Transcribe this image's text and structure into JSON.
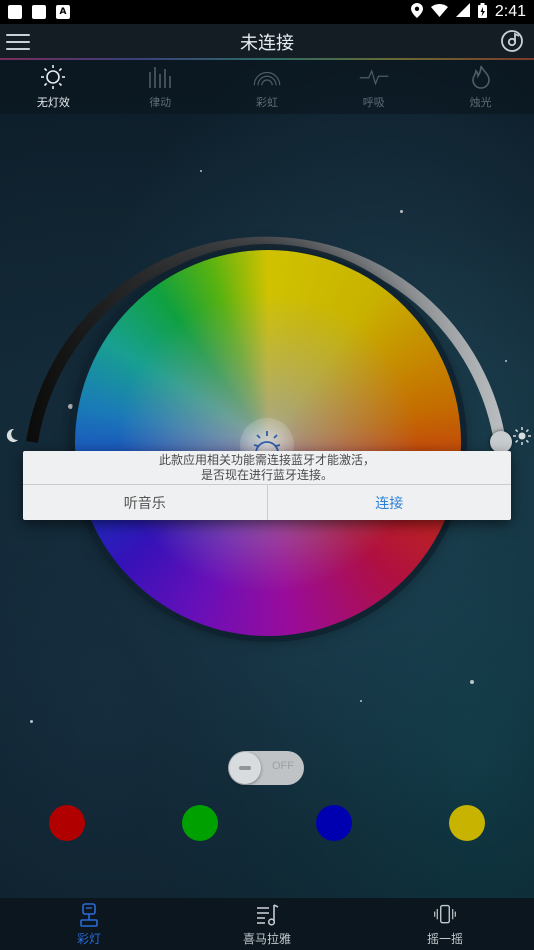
{
  "status_bar": {
    "time": "2:41"
  },
  "header": {
    "title": "未连接"
  },
  "modes": [
    {
      "label": "无灯效",
      "icon": "sun-icon",
      "active": true
    },
    {
      "label": "律动",
      "icon": "equalizer-icon",
      "active": false
    },
    {
      "label": "彩虹",
      "icon": "rainbow-icon",
      "active": false
    },
    {
      "label": "呼吸",
      "icon": "pulse-icon",
      "active": false
    },
    {
      "label": "烛光",
      "icon": "flame-icon",
      "active": false
    }
  ],
  "brightness": {
    "level": 1.0
  },
  "dialog": {
    "message_line1": "此款应用相关功能需连接蓝牙才能激活，",
    "message_line2": "是否现在进行蓝牙连接。",
    "cancel_label": "听音乐",
    "confirm_label": "连接"
  },
  "toggle": {
    "label": "OFF",
    "state": "off"
  },
  "preset_colors": [
    "#b00000",
    "#00a000",
    "#0000b0",
    "#c8b400"
  ],
  "bottom_nav": [
    {
      "label": "彩灯",
      "icon": "lamp-icon",
      "active": true
    },
    {
      "label": "喜马拉雅",
      "icon": "playlist-icon",
      "active": false
    },
    {
      "label": "摇一摇",
      "icon": "shake-phone-icon",
      "active": false
    }
  ]
}
